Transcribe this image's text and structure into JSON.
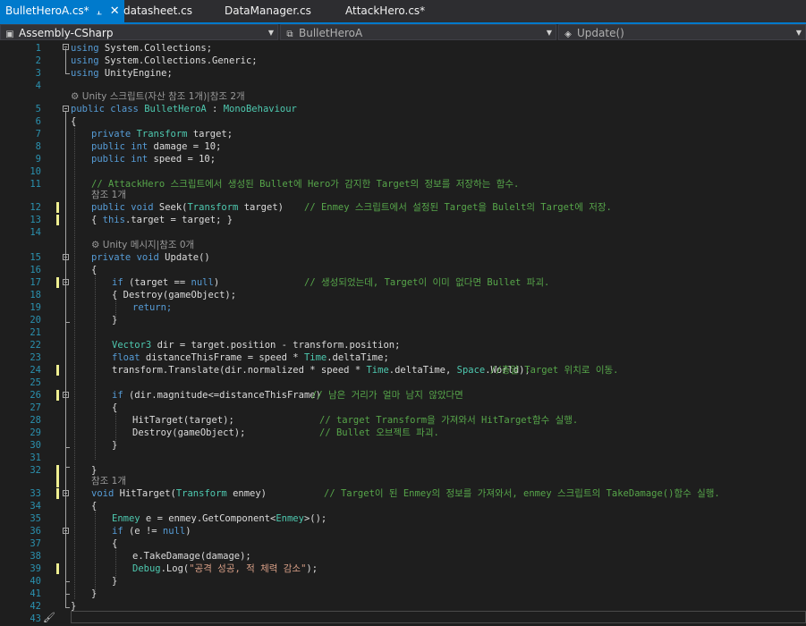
{
  "tabs": [
    {
      "label": "BulletHeroA.cs*",
      "active": true,
      "pin_icon": "pin-icon",
      "close_icon": "close-icon"
    },
    {
      "label": "datasheet.cs"
    },
    {
      "label": "DataManager.cs"
    },
    {
      "label": "AttackHero.cs*"
    }
  ],
  "nav": {
    "project": "Assembly-CSharp",
    "class": "BulletHeroA",
    "member": "Update()"
  },
  "codelens": {
    "unity_script": "Unity 스크립트(자산 참조 1개)|참조 2개",
    "ref1_a": "참조 1개",
    "unity_message": "Unity 메시지|참조 0개",
    "ref1_b": "참조 1개"
  },
  "code_lines": [
    {
      "n": "1",
      "text": "using System.Collections;"
    },
    {
      "n": "2",
      "text": "using System.Collections.Generic;"
    },
    {
      "n": "3",
      "text": "using UnityEngine;"
    },
    {
      "n": "4",
      "text": ""
    },
    {
      "n": "5",
      "text": "public class BulletHeroA : MonoBehaviour"
    },
    {
      "n": "6",
      "text": "{"
    },
    {
      "n": "7",
      "text": "private Transform target;"
    },
    {
      "n": "8",
      "text": "public int damage = 10;"
    },
    {
      "n": "9",
      "text": "public int speed = 10;"
    },
    {
      "n": "10",
      "text": ""
    },
    {
      "n": "11",
      "text": "// AttackHero 스크립트에서 생성된 Bullet에 Hero가 감지한 Target의 정보를 저장하는 함수."
    },
    {
      "n": "12",
      "text": "public void Seek(Transform target)"
    },
    {
      "n": "12c",
      "text": "// Enmey 스크립트에서 설정된 Target을 Bulelt의 Target에 저장."
    },
    {
      "n": "13",
      "text": "{ this.target = target; }"
    },
    {
      "n": "14",
      "text": ""
    },
    {
      "n": "15",
      "text": "private void Update()"
    },
    {
      "n": "16",
      "text": "{"
    },
    {
      "n": "17",
      "text": "if (target == null)"
    },
    {
      "n": "17c",
      "text": "// 생성되었는데, Target이 이미 없다면 Bullet 파괴."
    },
    {
      "n": "18",
      "text": "{ Destroy(gameObject);"
    },
    {
      "n": "19",
      "text": "return;"
    },
    {
      "n": "20",
      "text": "}"
    },
    {
      "n": "21",
      "text": ""
    },
    {
      "n": "22",
      "text": "Vector3 dir = target.position - transform.position;"
    },
    {
      "n": "23",
      "text": "float distanceThisFrame = speed * Time.deltaTime;"
    },
    {
      "n": "24",
      "text": "transform.Translate(dir.normalized * speed * Time.deltaTime, Space.World);"
    },
    {
      "n": "24c",
      "text": "//총알 Target 위치로 이동."
    },
    {
      "n": "25",
      "text": ""
    },
    {
      "n": "26",
      "text": "if (dir.magnitude<=distanceThisFrame)"
    },
    {
      "n": "26c",
      "text": "// 남은 거리가 얼마 남지 않았다면"
    },
    {
      "n": "27",
      "text": "{"
    },
    {
      "n": "28",
      "text": "HitTarget(target);"
    },
    {
      "n": "28c",
      "text": "// target Transform을 가져와서 HitTarget함수 실행."
    },
    {
      "n": "29",
      "text": "Destroy(gameObject);"
    },
    {
      "n": "29c",
      "text": "// Bullet 오브젝트 파괴."
    },
    {
      "n": "30",
      "text": "}"
    },
    {
      "n": "31",
      "text": ""
    },
    {
      "n": "32",
      "text": "}"
    },
    {
      "n": "33",
      "text": "void HitTarget(Transform enmey)"
    },
    {
      "n": "33c",
      "text": "// Target이 된 Enmey의 정보를 가져와서, enmey 스크립트의 TakeDamage()함수 실행."
    },
    {
      "n": "34",
      "text": "{"
    },
    {
      "n": "35",
      "text": "Enmey e = enmey.GetComponent<Enmey>();"
    },
    {
      "n": "36",
      "text": "if (e != null)"
    },
    {
      "n": "37",
      "text": "{"
    },
    {
      "n": "38",
      "text": "e.TakeDamage(damage);"
    },
    {
      "n": "39",
      "text": "Debug.Log(\"공격 성공, 적 체력 감소\");"
    },
    {
      "n": "40",
      "text": "}"
    },
    {
      "n": "41",
      "text": "}"
    },
    {
      "n": "42",
      "text": "}"
    },
    {
      "n": "43",
      "text": ""
    }
  ],
  "colors": {
    "background": "#1e1e1e",
    "keyword": "#569cd6",
    "type": "#4ec9b0",
    "comment": "#57a64a",
    "string": "#d69d85",
    "line_number": "#2b91af",
    "accent": "#007acc",
    "change_marker": "#efef91"
  }
}
